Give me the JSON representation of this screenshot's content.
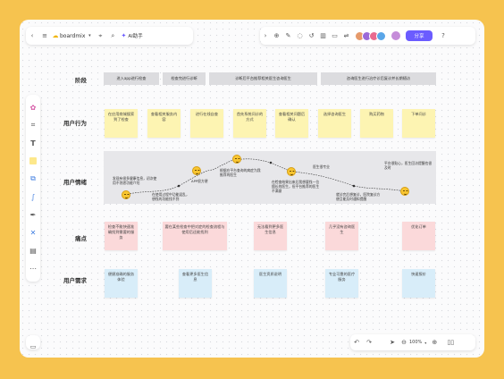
{
  "app": {
    "name": "boardmix",
    "ai_label": "AI助手",
    "share_label": "分享"
  },
  "stages": {
    "label": "阶段",
    "items": [
      "进入app进行检查",
      "检查完进行诊断",
      "诊断后平台推荐相关医生咨询医生",
      "咨询医生进行治疗诊后复诊并长期随访"
    ]
  },
  "behavior": {
    "label": "用户行为",
    "notes": [
      "在应用商城搜索到了检查",
      "查看相关服务内容",
      "进行在线自查",
      "首先系统问诊的方式",
      "查看相关问题后确认",
      "选择咨询医生",
      "购买药物",
      "下单问诊"
    ]
  },
  "emotion": {
    "label": "用户情绪",
    "texts": [
      "发现有很多健康信息，初次使用不熟悉功能介绍",
      "在使用过程中功能混乱，想找的功能找不到",
      "APP很方便",
      "根据在平台查询的病症为我推荐的医生",
      "在检查结果出来后我想要找一位擅长的医生，但平台推荐的医生不满意",
      "医生很专业",
      "就诊完后想复诊，医院复诊方便且能及时通知提醒",
      "平台很贴心，医生回访提醒也很及时",
      "整体体验下来平台医疗服务比较全面"
    ]
  },
  "pain": {
    "label": "痛点",
    "notes": [
      "检查不能快速准确找到需要的服务",
      "要在某些检查中把对症的检查流程与使用后还能找到",
      "无法看到更多医生信息",
      "几乎没有咨询医生",
      "优化订单"
    ]
  },
  "needs": {
    "label": "用户需求",
    "notes": [
      "便捷准确的服务体验",
      "查看更多医生信息",
      "医生资质说明",
      "专业可靠的医疗服务",
      "快速报价"
    ]
  },
  "zoom": "100%"
}
